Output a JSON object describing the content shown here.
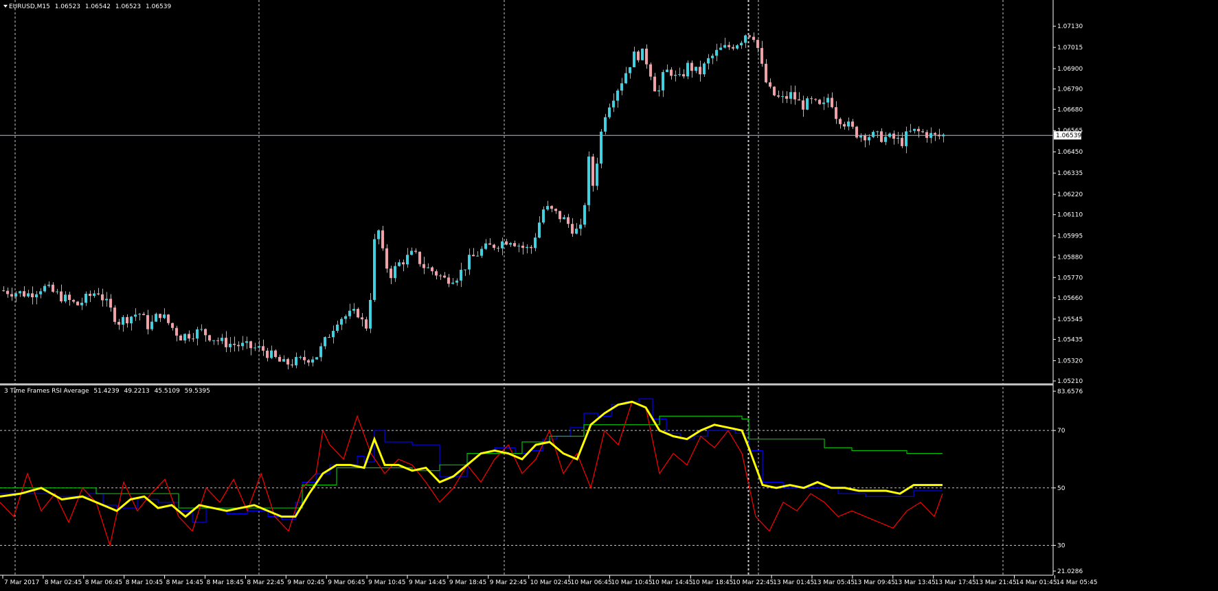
{
  "chart_data": [
    {
      "type": "candlestick",
      "symbol_header": "EURUSD,M15",
      "ohlc_values": [
        "1.06523",
        "1.06542",
        "1.06523",
        "1.06539"
      ],
      "current_price": 1.06539,
      "current_price_label": "1.06539",
      "ylim": [
        1.0521,
        1.0719
      ],
      "y_ticks": [
        1.0713,
        1.07015,
        1.069,
        1.0679,
        1.0668,
        1.06565,
        1.0645,
        1.06335,
        1.0622,
        1.0611,
        1.05995,
        1.0588,
        1.0577,
        1.0566,
        1.05545,
        1.05435,
        1.0532,
        1.0521
      ],
      "y_tick_labels": [
        "1.07130",
        "1.07015",
        "1.06900",
        "1.06790",
        "1.06680",
        "1.06565",
        "1.06450",
        "1.06335",
        "1.06220",
        "1.06110",
        "1.05995",
        "1.05880",
        "1.05770",
        "1.05660",
        "1.05545",
        "1.05435",
        "1.05320",
        "1.05210"
      ],
      "price_path_x": [
        0,
        40,
        60,
        90,
        110,
        140,
        170,
        200,
        215,
        230,
        260,
        290,
        320,
        350,
        380,
        410,
        435,
        460,
        475,
        490,
        520,
        530,
        540,
        545,
        555,
        565,
        580,
        600,
        615,
        630,
        645,
        665,
        680,
        700,
        720,
        740,
        760,
        770,
        790,
        805,
        820,
        835,
        845,
        855,
        862,
        870,
        880,
        890,
        905,
        920,
        935,
        945,
        955,
        962,
        972,
        985,
        1000,
        1015,
        1030,
        1045,
        1060,
        1075,
        1085,
        1095,
        1102,
        1110,
        1120,
        1135,
        1150,
        1165,
        1180,
        1195,
        1205,
        1215,
        1230,
        1245,
        1260,
        1280,
        1300,
        1310,
        1320,
        1330,
        1345,
        1360,
        1372
      ],
      "price_path_y": [
        1.057,
        1.0568,
        1.0572,
        1.0566,
        1.0562,
        1.057,
        1.0553,
        1.0558,
        1.055,
        1.0558,
        1.0545,
        1.0548,
        1.0542,
        1.054,
        1.0538,
        1.053,
        1.0532,
        1.0535,
        1.0545,
        1.0555,
        1.0558,
        1.0548,
        1.0575,
        1.061,
        1.059,
        1.0578,
        1.0585,
        1.059,
        1.0583,
        1.058,
        1.0576,
        1.0578,
        1.0586,
        1.0592,
        1.0595,
        1.0598,
        1.0593,
        1.0592,
        1.0615,
        1.0612,
        1.0608,
        1.0602,
        1.0603,
        1.064,
        1.0625,
        1.065,
        1.0668,
        1.0675,
        1.0685,
        1.0697,
        1.0698,
        1.0688,
        1.0675,
        1.0685,
        1.069,
        1.0683,
        1.0692,
        1.0687,
        1.0695,
        1.07,
        1.0702,
        1.0705,
        1.071,
        1.0708,
        1.07,
        1.0685,
        1.0677,
        1.0673,
        1.0676,
        1.067,
        1.0672,
        1.0668,
        1.0676,
        1.0665,
        1.066,
        1.0655,
        1.0654,
        1.0653,
        1.0652,
        1.065,
        1.0655,
        1.0656,
        1.0655,
        1.0653,
        1.0654
      ]
    },
    {
      "type": "line",
      "indicator_header": "3 Time Frames RSI Average",
      "indicator_values": [
        "51.4239",
        "49.2213",
        "45.5109",
        "59.5395"
      ],
      "ylim": [
        21.0286,
        83.6576
      ],
      "y_ticks": [
        83.6576,
        70,
        50,
        30,
        21.0286
      ],
      "y_tick_labels": [
        "83.6576",
        "70",
        "50",
        "30",
        "21.0286"
      ],
      "levels": [
        70,
        50,
        30
      ],
      "series": [
        {
          "color": "#0000ff",
          "x": [
            0,
            80,
            130,
            150,
            170,
            200,
            230,
            260,
            280,
            300,
            330,
            360,
            390,
            410,
            430,
            440,
            460,
            480,
            520,
            530,
            545,
            560,
            600,
            640,
            680,
            720,
            750,
            770,
            790,
            810,
            830,
            850,
            870,
            890,
            910,
            930,
            950,
            970,
            990,
            1010,
            1030,
            1050,
            1070,
            1090,
            1110,
            1140,
            1180,
            1220,
            1260,
            1300,
            1330,
            1372
          ],
          "y": [
            48,
            47,
            48,
            44,
            43,
            46,
            45,
            42,
            38,
            43,
            41,
            42,
            40,
            39,
            45,
            52,
            55,
            58,
            61,
            59,
            70,
            66,
            65,
            54,
            62,
            64,
            62,
            63,
            67,
            68,
            71,
            76,
            75,
            79,
            80,
            81,
            74,
            69,
            67,
            68,
            70,
            70,
            69,
            63,
            52,
            50,
            50,
            48,
            47,
            47,
            49,
            49
          ]
        },
        {
          "color": "#00c000",
          "x": [
            0,
            80,
            110,
            140,
            170,
            200,
            230,
            260,
            300,
            330,
            360,
            390,
            420,
            440,
            460,
            490,
            520,
            560,
            600,
            640,
            680,
            720,
            760,
            800,
            850,
            880,
            920,
            960,
            1000,
            1030,
            1080,
            1090,
            1120,
            1160,
            1200,
            1240,
            1280,
            1320,
            1372
          ],
          "y": [
            50,
            50,
            50,
            48,
            48,
            48,
            48,
            43,
            43,
            43,
            43,
            43,
            43,
            51,
            51,
            57,
            57,
            57,
            56,
            58,
            62,
            62,
            66,
            68,
            72,
            72,
            72,
            75,
            75,
            75,
            74,
            67,
            67,
            67,
            64,
            63,
            63,
            62,
            62
          ]
        },
        {
          "color": "#ff0000",
          "x": [
            0,
            20,
            40,
            60,
            80,
            100,
            120,
            140,
            160,
            180,
            200,
            220,
            240,
            260,
            280,
            300,
            320,
            340,
            360,
            380,
            400,
            420,
            440,
            460,
            470,
            480,
            500,
            520,
            540,
            560,
            580,
            600,
            620,
            640,
            660,
            680,
            700,
            720,
            740,
            760,
            780,
            800,
            820,
            840,
            860,
            880,
            900,
            920,
            940,
            960,
            980,
            1000,
            1020,
            1040,
            1060,
            1080,
            1100,
            1120,
            1140,
            1160,
            1180,
            1200,
            1220,
            1240,
            1260,
            1280,
            1300,
            1320,
            1340,
            1360,
            1372
          ],
          "y": [
            45,
            40,
            55,
            42,
            48,
            38,
            50,
            45,
            30,
            52,
            42,
            48,
            53,
            40,
            35,
            50,
            45,
            53,
            42,
            55,
            40,
            35,
            50,
            55,
            70,
            65,
            60,
            75,
            62,
            55,
            60,
            58,
            52,
            45,
            50,
            58,
            52,
            60,
            65,
            55,
            60,
            70,
            55,
            62,
            50,
            70,
            65,
            80,
            78,
            55,
            62,
            58,
            68,
            64,
            70,
            62,
            40,
            35,
            45,
            42,
            48,
            45,
            40,
            42,
            40,
            38,
            36,
            42,
            45,
            40,
            48
          ]
        },
        {
          "color": "#ffff00",
          "x": [
            0,
            30,
            60,
            90,
            120,
            150,
            170,
            190,
            210,
            230,
            250,
            270,
            290,
            310,
            330,
            350,
            370,
            390,
            410,
            430,
            450,
            470,
            490,
            510,
            530,
            545,
            560,
            580,
            600,
            620,
            640,
            660,
            680,
            700,
            720,
            740,
            760,
            780,
            800,
            820,
            840,
            860,
            880,
            900,
            920,
            940,
            960,
            980,
            1000,
            1020,
            1040,
            1060,
            1080,
            1090,
            1110,
            1130,
            1150,
            1170,
            1190,
            1210,
            1230,
            1250,
            1270,
            1290,
            1310,
            1330,
            1350,
            1372
          ],
          "y": [
            47,
            48,
            50,
            46,
            47,
            44,
            42,
            46,
            47,
            43,
            44,
            40,
            44,
            43,
            42,
            43,
            44,
            42,
            40,
            40,
            48,
            55,
            58,
            58,
            57,
            67,
            58,
            58,
            56,
            57,
            52,
            54,
            58,
            62,
            63,
            62,
            60,
            65,
            66,
            62,
            60,
            72,
            76,
            79,
            80,
            78,
            70,
            68,
            67,
            70,
            72,
            71,
            70,
            64,
            51,
            50,
            51,
            50,
            52,
            50,
            50,
            49,
            49,
            49,
            48,
            51,
            51,
            51
          ]
        }
      ]
    }
  ],
  "time_axis": {
    "labels": [
      "7 Mar 2017",
      "8 Mar 02:45",
      "8 Mar 06:45",
      "8 Mar 10:45",
      "8 Mar 14:45",
      "8 Mar 18:45",
      "8 Mar 22:45",
      "9 Mar 02:45",
      "9 Mar 06:45",
      "9 Mar 10:45",
      "9 Mar 14:45",
      "9 Mar 18:45",
      "9 Mar 22:45",
      "10 Mar 02:45",
      "10 Mar 06:45",
      "10 Mar 10:45",
      "10 Mar 14:45",
      "10 Mar 18:45",
      "10 Mar 22:45",
      "13 Mar 01:45",
      "13 Mar 05:45",
      "13 Mar 09:45",
      "13 Mar 13:45",
      "13 Mar 17:45",
      "13 Mar 21:45",
      "14 Mar 01:45",
      "14 Mar 05:45"
    ]
  },
  "colors": {
    "background": "#000000",
    "bull": "#40d0e0",
    "bear": "#f0a0a8",
    "grid": "#c8c8c8",
    "axis": "#ffffff"
  },
  "icons": {
    "header_arrow": "triangle-down-icon"
  }
}
